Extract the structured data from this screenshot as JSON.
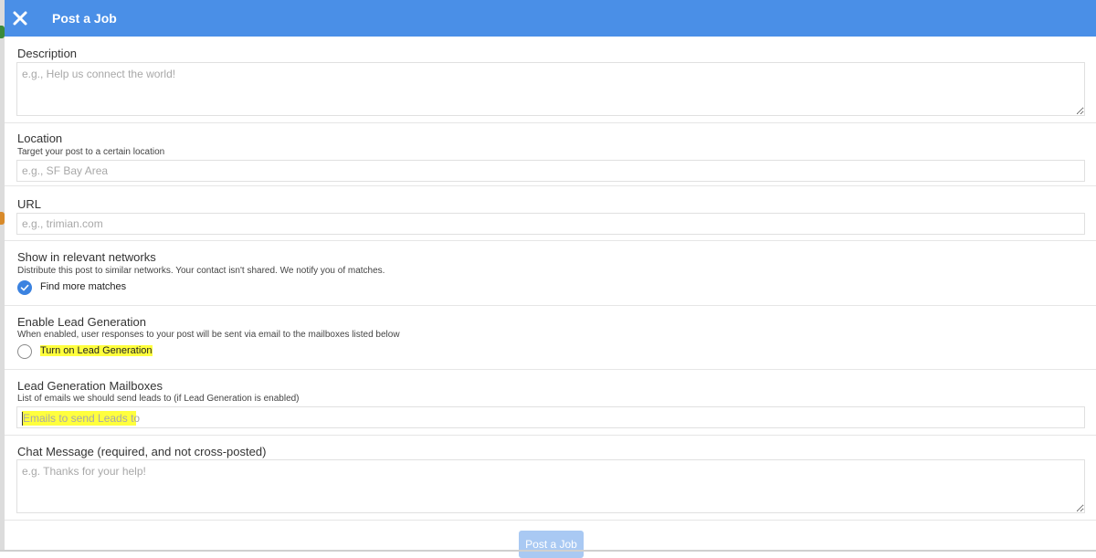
{
  "header": {
    "title": "Post a Job",
    "close_icon": "close-icon",
    "background": "#4a8fe7"
  },
  "description": {
    "label": "Description",
    "placeholder": "e.g., Help us connect the world!"
  },
  "location": {
    "label": "Location",
    "hint": "Target your post to a certain location",
    "placeholder": "e.g., SF Bay Area"
  },
  "url": {
    "label": "URL",
    "placeholder": "e.g., trimian.com"
  },
  "networks": {
    "label": "Show in relevant networks",
    "hint": "Distribute this post to similar networks. Your contact isn't shared. We notify you of matches.",
    "checkbox_label": "Find more matches",
    "checked": true
  },
  "lead_generation": {
    "label": "Enable Lead Generation",
    "hint": "When enabled, user responses to your post will be sent via email to the mailboxes listed below",
    "checkbox_label": "Turn on Lead Generation",
    "checked": false
  },
  "mailboxes": {
    "label": "Lead Generation Mailboxes",
    "hint": "List of emails we should send leads to (if Lead Generation is enabled)",
    "placeholder": "Emails to send Leads to"
  },
  "chat_message": {
    "label": "Chat Message (required, and not cross-posted)",
    "placeholder": "e.g. Thanks for your help!"
  },
  "submit": {
    "label": "Post a Job",
    "color": "#a9c9f3"
  },
  "colors": {
    "accent": "#3b82e0",
    "highlight": "#ffff3d"
  }
}
